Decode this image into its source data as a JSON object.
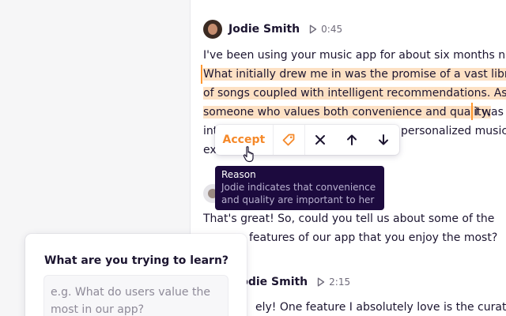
{
  "transcript": {
    "block1": {
      "speaker": "Jodie Smith",
      "time": "0:45",
      "lines": [
        "I've been using your music app for about six months now.",
        "What initially drew me in was the promise of a vast library",
        "of songs coupled with intelligent recommendations. As",
        "someone who values both convenience and quality,",
        "I was",
        "int",
        "personalized music",
        "ex"
      ]
    },
    "block2": {
      "lines": [
        "That's great! So, could you tell us about some of the",
        "features of our app that you enjoy the most?"
      ]
    },
    "block3": {
      "speaker": "Jodie Smith",
      "time": "2:15",
      "line": "ely! One feature I absolutely love is the curated pl"
    }
  },
  "toolbar": {
    "accept_label": "Accept",
    "accent_color": "#f5892a",
    "icons": [
      "tag-icon",
      "close-icon",
      "arrow-up-icon",
      "arrow-down-icon"
    ]
  },
  "tooltip": {
    "title": "Reason",
    "lines": [
      "Jodie indicates that convenience",
      "and quality are important to her"
    ]
  },
  "panel": {
    "title": "What are you trying to learn?",
    "placeholder_lines": [
      "e.g. What do users value the",
      "most in our app?"
    ]
  },
  "colors": {
    "highlight": "#fde1c4",
    "highlight_bar": "#ff9730",
    "tooltip_bg": "#1c0a3e"
  }
}
